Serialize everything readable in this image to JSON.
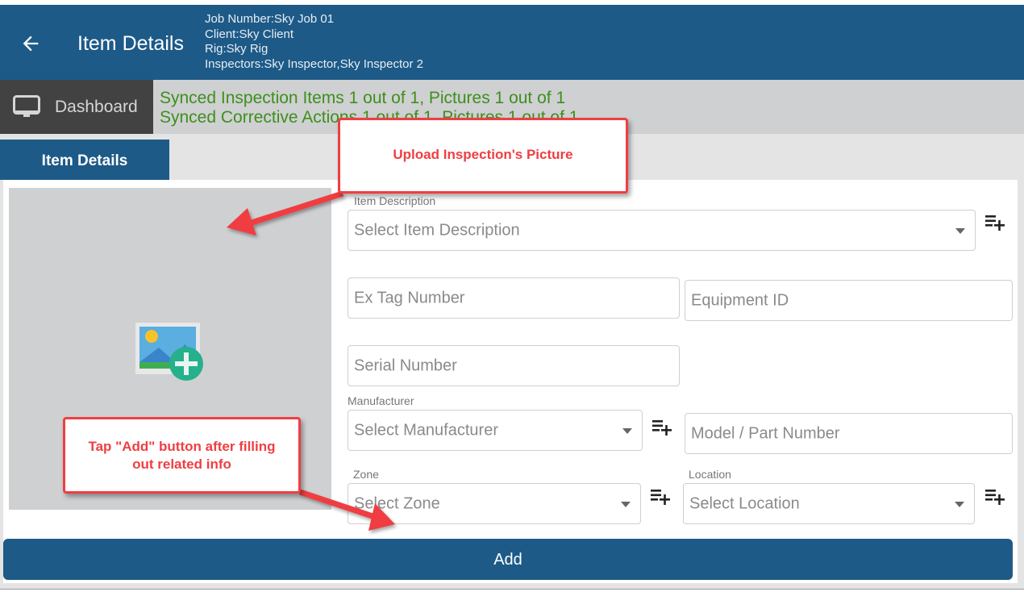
{
  "app_bar": {
    "back_icon": "arrow-left-icon",
    "title": "Item Details",
    "job_info": {
      "job_number": "Job Number:Sky Job 01",
      "client": "Client:Sky Client",
      "rig": "Rig:Sky Rig",
      "inspectors": "Inspectors:Sky Inspector,Sky Inspector 2"
    }
  },
  "sync_bar": {
    "dashboard_icon": "monitor-icon",
    "dashboard_label": "Dashboard",
    "line1": "Synced Inspection Items 1 out of 1, Pictures 1 out of 1",
    "line2": "Synced Corrective Actions 1 out of 1, Pictures 1 out of 1",
    "text_color": "#3e8f1c"
  },
  "tabs": [
    {
      "label": "Item Details",
      "active": true
    }
  ],
  "image_upload": {
    "icon": "add-image-icon"
  },
  "form": {
    "item_description": {
      "label": "Item Description",
      "placeholder": "Select Item Description"
    },
    "ex_tag_number": {
      "placeholder": "Ex Tag Number"
    },
    "equipment_id": {
      "placeholder": "Equipment ID"
    },
    "serial_number": {
      "placeholder": "Serial Number"
    },
    "manufacturer": {
      "label": "Manufacturer",
      "placeholder": "Select Manufacturer"
    },
    "model_part_number": {
      "placeholder": "Model / Part Number"
    },
    "zone": {
      "label": "Zone",
      "placeholder": "Select Zone"
    },
    "location": {
      "label": "Location",
      "placeholder": "Select Location"
    },
    "add_list_icon": "playlist-add-icon"
  },
  "add_button": {
    "label": "Add"
  },
  "annotations": {
    "callout_upload": "Upload Inspection's Picture",
    "callout_add": "Tap \"Add\" button after filling out related info",
    "color": "#ef3e42"
  },
  "colors": {
    "primary": "#1d5a87",
    "dashboard_bg": "#424242",
    "sync_bg": "#cfd0d2"
  }
}
